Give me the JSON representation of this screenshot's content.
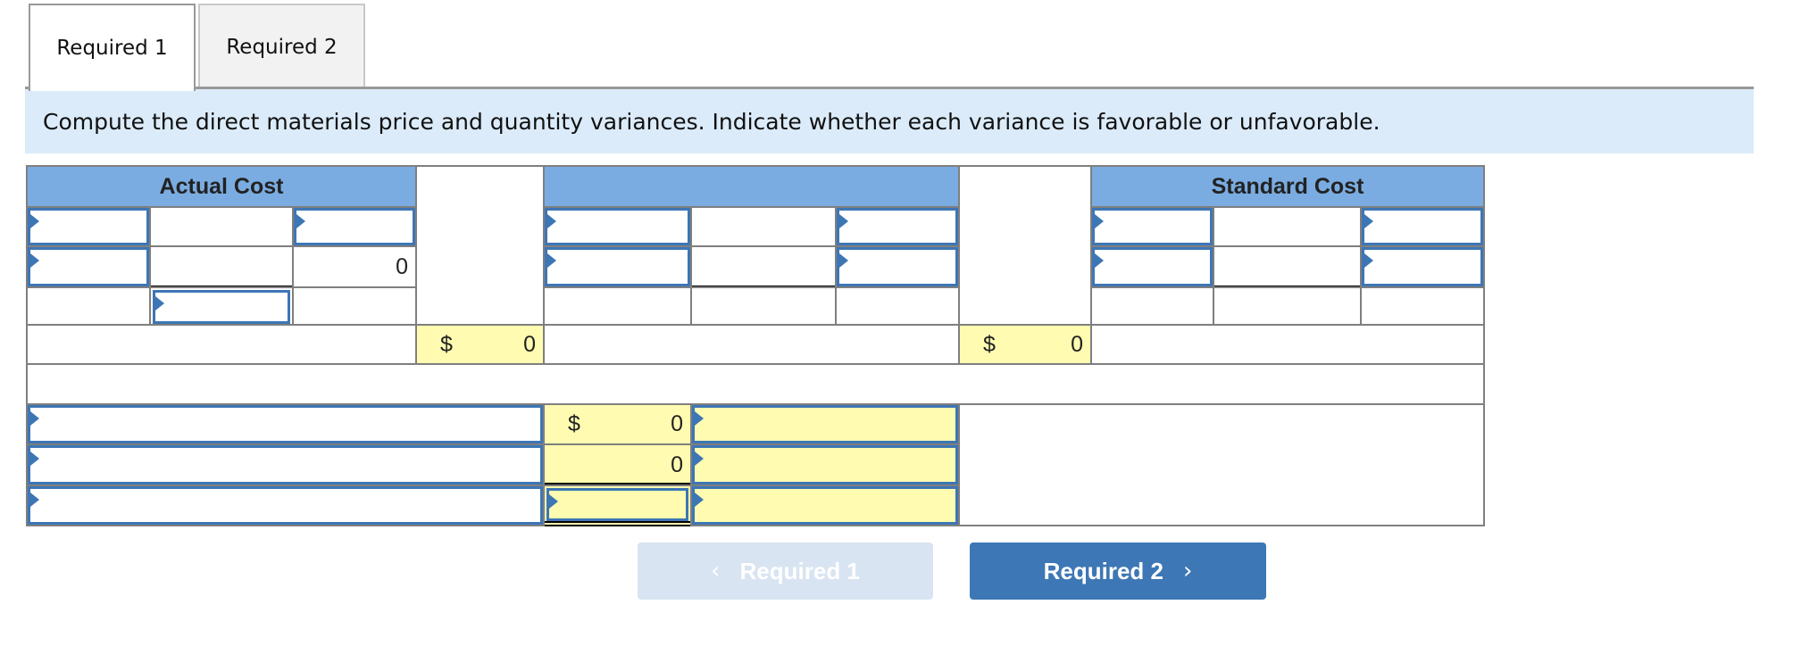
{
  "tabs": [
    {
      "label": "Required 1",
      "active": true
    },
    {
      "label": "Required 2",
      "active": false
    }
  ],
  "instruction": "Compute the direct materials price and quantity variances. Indicate whether each variance is favorable or unfavorable.",
  "table": {
    "headers": {
      "actual_cost": "Actual Cost",
      "middle": "",
      "standard_cost": "Standard Cost"
    },
    "actual_row2_value": "0",
    "actual_total": {
      "currency": "$",
      "value": "0"
    },
    "middle_total": {
      "currency": "$",
      "value": "0"
    },
    "variances": [
      {
        "label": "",
        "currency": "$",
        "amount": "0",
        "type": ""
      },
      {
        "label": "",
        "currency": "",
        "amount": "0",
        "type": ""
      },
      {
        "label": "",
        "currency": "",
        "amount": "",
        "type": ""
      }
    ]
  },
  "navigation": {
    "prev_label": "Required 1",
    "prev_icon": "chevron-left-icon",
    "next_label": "Required 2",
    "next_icon": "chevron-right-icon",
    "prev_enabled": false,
    "next_enabled": true
  },
  "colors": {
    "header_blue": "#7aace1",
    "banner_blue": "#dbebf9",
    "input_border": "#3d76b5",
    "computed_yellow": "#fffcb1",
    "next_button": "#3d77b5",
    "prev_button_disabled": "#d8e4f1"
  }
}
